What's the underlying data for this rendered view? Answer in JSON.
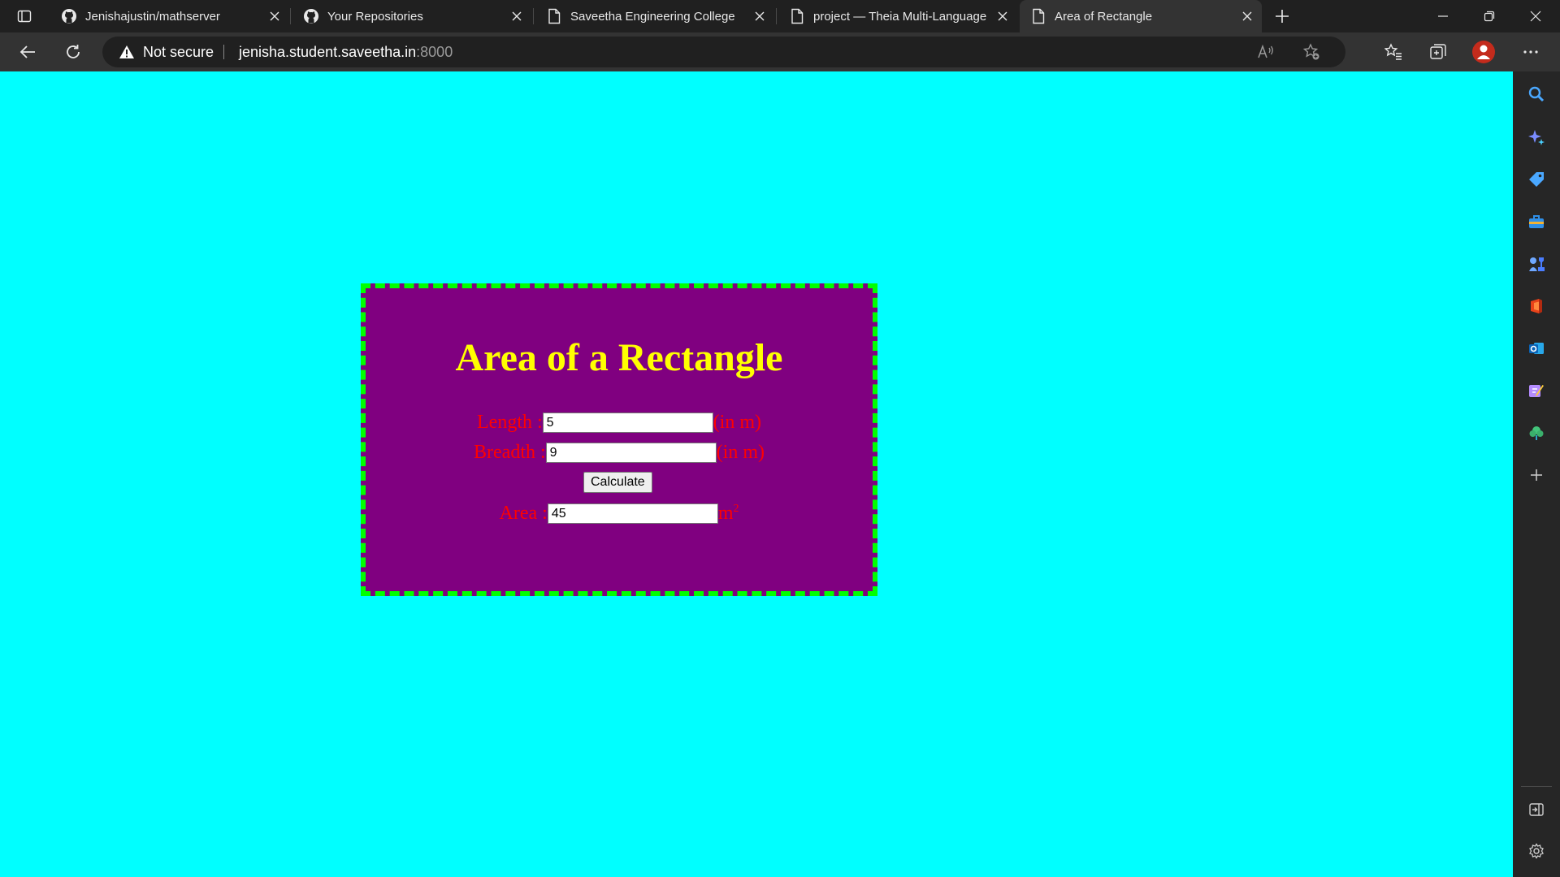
{
  "tabs": [
    {
      "title": "Jenishajustin/mathserver",
      "icon": "github-icon"
    },
    {
      "title": "Your Repositories",
      "icon": "github-icon"
    },
    {
      "title": "Saveetha Engineering College",
      "icon": "page-icon"
    },
    {
      "title": "project — Theia Multi-Language",
      "icon": "page-icon"
    },
    {
      "title": "Area of Rectangle",
      "icon": "page-icon",
      "active": true
    }
  ],
  "address_bar": {
    "security_label": "Not secure",
    "url_host": "jenisha.student.saveetha.in",
    "url_port": ":8000"
  },
  "page": {
    "heading": "Area of a Rectangle",
    "length_label": "Length :",
    "length_value": "5",
    "breadth_label": "Breadth :",
    "breadth_value": "9",
    "unit": "(in m)",
    "calculate_label": "Calculate",
    "area_label": "Area :",
    "area_value": "45",
    "area_unit": "m",
    "area_unit_sup": "2"
  },
  "colors": {
    "page_background": "#00ffff",
    "card_background": "#800080",
    "card_border": "#00ff00",
    "heading": "#ffff00",
    "labels": "#ff0000"
  },
  "sidebar_icons": [
    "search-icon",
    "copilot-icon",
    "shopping-tag-icon",
    "tools-briefcase-icon",
    "games-icon",
    "office-icon",
    "outlook-icon",
    "designer-icon",
    "tree-icon",
    "add-icon",
    "hide-sidebar-icon",
    "settings-icon"
  ]
}
